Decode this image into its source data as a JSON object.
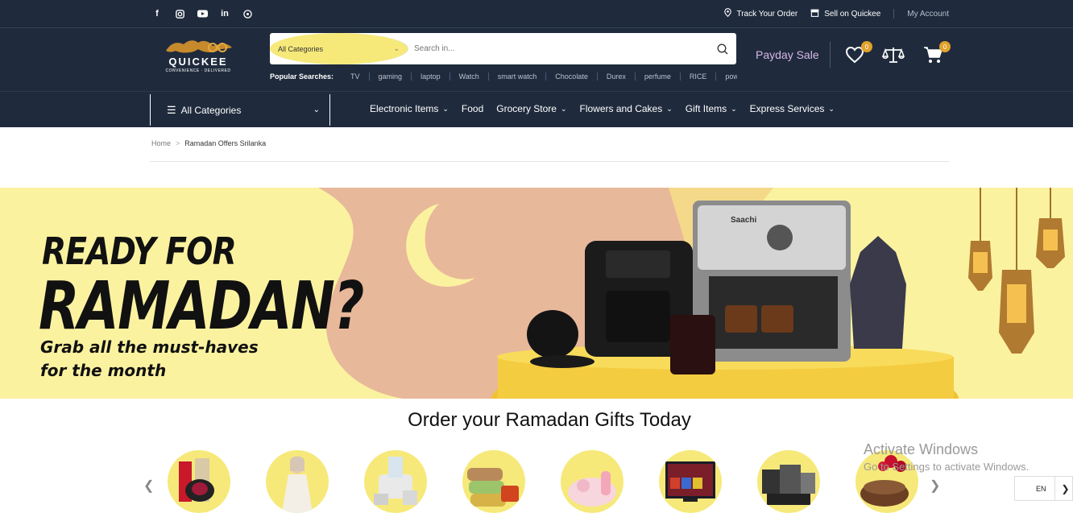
{
  "social": [
    "facebook-icon",
    "instagram-icon",
    "youtube-icon",
    "linkedin-icon",
    "whatsapp-icon"
  ],
  "toplinks": {
    "track": "Track Your Order",
    "sell": "Sell on Quickee",
    "account": "My Account"
  },
  "logo": {
    "name": "QUICKEE",
    "tagline": "CONVENIENCE · DELIVERED"
  },
  "search": {
    "category": "All Categories",
    "placeholder": "Search in..."
  },
  "popular": {
    "title": "Popular Searches:",
    "items": [
      "TV",
      "gaming",
      "laptop",
      "Watch",
      "smart watch",
      "Chocolate",
      "Durex",
      "perfume",
      "RICE",
      "power"
    ]
  },
  "header": {
    "payday": "Payday Sale",
    "wishlist_count": "0",
    "cart_count": "0"
  },
  "nav": {
    "all_categories": "All Categories",
    "items": [
      "Electronic Items",
      "Food",
      "Grocery Store",
      "Flowers and Cakes",
      "Gift Items",
      "Express Services"
    ]
  },
  "breadcrumb": {
    "home": "Home",
    "sep": ">",
    "current": "Ramadan Offers Srilanka"
  },
  "banner": {
    "line1": "READY FOR",
    "line2": "RAMADAN?",
    "line3": "Grab all the must-haves",
    "line4": "for the month",
    "brand_machine": "Saachi"
  },
  "section": {
    "title": "Order your Ramadan Gifts Today"
  },
  "windows": {
    "title": "Activate Windows",
    "subtitle": "Go to Settings to activate Windows."
  },
  "lang": "EN",
  "colors": {
    "header_bg": "#1f2b3d",
    "accent_badge": "#e1a22b",
    "payday": "#d8b7e6",
    "banner_yellow": "#fbf2a0",
    "banner_peach": "#e8b89a"
  }
}
